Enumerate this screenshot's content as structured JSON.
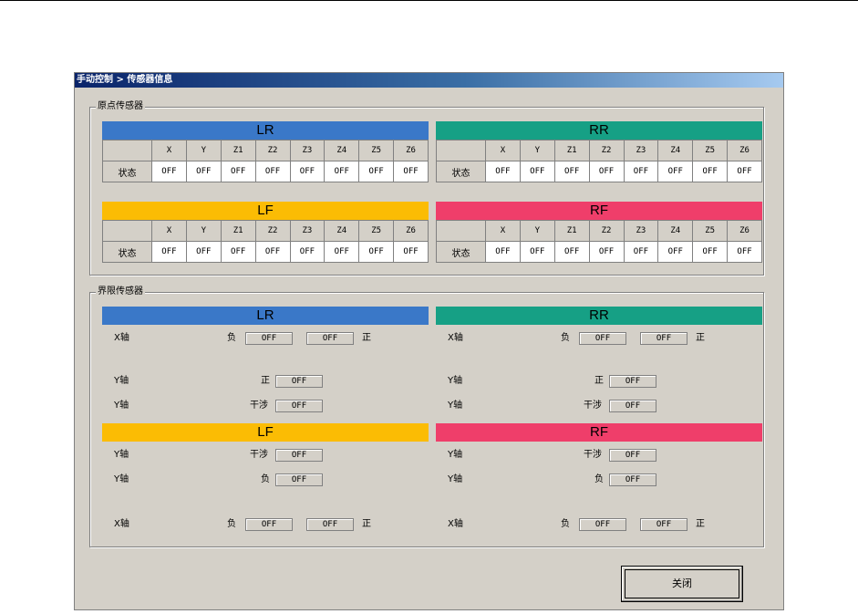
{
  "window": {
    "title": "手动控制 > 传感器信息"
  },
  "origin_group": {
    "legend": "原点传感器",
    "state_label": "状态",
    "columns": [
      "X",
      "Y",
      "Z1",
      "Z2",
      "Z3",
      "Z4",
      "Z5",
      "Z6"
    ],
    "panels": [
      {
        "id": "lr",
        "title": "LR",
        "color": "#3a78c8",
        "values": [
          "OFF",
          "OFF",
          "OFF",
          "OFF",
          "OFF",
          "OFF",
          "OFF",
          "OFF"
        ]
      },
      {
        "id": "rr",
        "title": "RR",
        "color": "#16a085",
        "values": [
          "OFF",
          "OFF",
          "OFF",
          "OFF",
          "OFF",
          "OFF",
          "OFF",
          "OFF"
        ]
      },
      {
        "id": "lf",
        "title": "LF",
        "color": "#fbbc04",
        "values": [
          "OFF",
          "OFF",
          "OFF",
          "OFF",
          "OFF",
          "OFF",
          "OFF",
          "OFF"
        ]
      },
      {
        "id": "rf",
        "title": "RF",
        "color": "#ef3e6a",
        "values": [
          "OFF",
          "OFF",
          "OFF",
          "OFF",
          "OFF",
          "OFF",
          "OFF",
          "OFF"
        ]
      }
    ]
  },
  "limit_group": {
    "legend": "界限传感器",
    "neg": "负",
    "pos": "正",
    "interf": "干涉",
    "lr": {
      "title": "LR",
      "color": "#3a78c8",
      "x_axis": "X轴",
      "x_neg": "OFF",
      "x_pos": "OFF",
      "y1_axis": "Y轴",
      "y1_val": "OFF",
      "y2_axis": "Y轴",
      "y2_val": "OFF"
    },
    "rr": {
      "title": "RR",
      "color": "#16a085",
      "x_axis": "X轴",
      "x_neg": "OFF",
      "x_pos": "OFF",
      "y1_axis": "Y轴",
      "y1_val": "OFF",
      "y2_axis": "Y轴",
      "y2_val": "OFF"
    },
    "lf": {
      "title": "LF",
      "color": "#fbbc04",
      "y1_axis": "Y轴",
      "y1_val": "OFF",
      "y2_axis": "Y轴",
      "y2_val": "OFF",
      "x_axis": "X轴",
      "x_neg": "OFF",
      "x_pos": "OFF"
    },
    "rf": {
      "title": "RF",
      "color": "#ef3e6a",
      "y1_axis": "Y轴",
      "y1_val": "OFF",
      "y2_axis": "Y轴",
      "y2_val": "OFF",
      "x_axis": "X轴",
      "x_neg": "OFF",
      "x_pos": "OFF"
    }
  },
  "close_button": {
    "label": "关闭"
  }
}
